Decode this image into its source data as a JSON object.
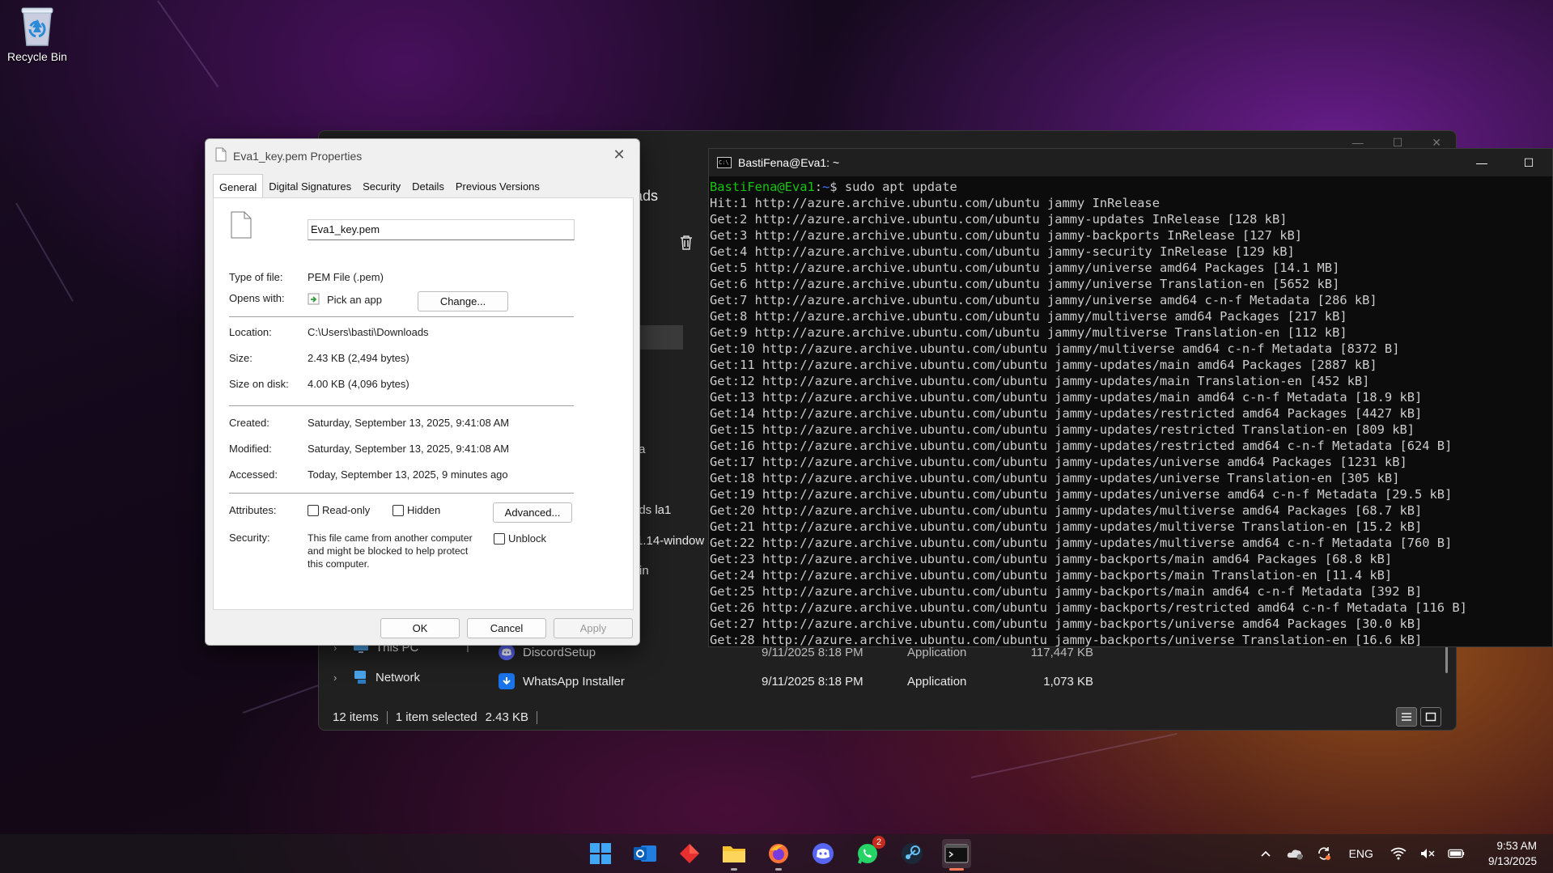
{
  "desktop": {
    "recycle_bin_label": "Recycle Bin"
  },
  "explorer": {
    "title_fragment": "ads",
    "fragments": [
      "ta",
      "nds la1",
      "1.14-window",
      "in"
    ],
    "nav": [
      {
        "label": "This PC"
      },
      {
        "label": "Network"
      }
    ],
    "rows": [
      {
        "name": "DiscordSetup",
        "date": "9/11/2025 8:18 PM",
        "type": "Application",
        "size": "117,447 KB"
      },
      {
        "name": "WhatsApp Installer",
        "date": "9/11/2025 8:18 PM",
        "type": "Application",
        "size": "1,073 KB"
      }
    ],
    "status": {
      "items": "12 items",
      "selected": "1 item selected",
      "size": "2.43 KB"
    }
  },
  "terminal": {
    "title": "BastiFena@Eva1: ~",
    "prompt_user": "BastiFena@Eva1",
    "prompt_sep": ":",
    "prompt_path": "~",
    "prompt_cmd": "$ sudo apt update",
    "lines": [
      "Hit:1 http://azure.archive.ubuntu.com/ubuntu jammy InRelease",
      "Get:2 http://azure.archive.ubuntu.com/ubuntu jammy-updates InRelease [128 kB]",
      "Get:3 http://azure.archive.ubuntu.com/ubuntu jammy-backports InRelease [127 kB]",
      "Get:4 http://azure.archive.ubuntu.com/ubuntu jammy-security InRelease [129 kB]",
      "Get:5 http://azure.archive.ubuntu.com/ubuntu jammy/universe amd64 Packages [14.1 MB]",
      "Get:6 http://azure.archive.ubuntu.com/ubuntu jammy/universe Translation-en [5652 kB]",
      "Get:7 http://azure.archive.ubuntu.com/ubuntu jammy/universe amd64 c-n-f Metadata [286 kB]",
      "Get:8 http://azure.archive.ubuntu.com/ubuntu jammy/multiverse amd64 Packages [217 kB]",
      "Get:9 http://azure.archive.ubuntu.com/ubuntu jammy/multiverse Translation-en [112 kB]",
      "Get:10 http://azure.archive.ubuntu.com/ubuntu jammy/multiverse amd64 c-n-f Metadata [8372 B]",
      "Get:11 http://azure.archive.ubuntu.com/ubuntu jammy-updates/main amd64 Packages [2887 kB]",
      "Get:12 http://azure.archive.ubuntu.com/ubuntu jammy-updates/main Translation-en [452 kB]",
      "Get:13 http://azure.archive.ubuntu.com/ubuntu jammy-updates/main amd64 c-n-f Metadata [18.9 kB]",
      "Get:14 http://azure.archive.ubuntu.com/ubuntu jammy-updates/restricted amd64 Packages [4427 kB]",
      "Get:15 http://azure.archive.ubuntu.com/ubuntu jammy-updates/restricted Translation-en [809 kB]",
      "Get:16 http://azure.archive.ubuntu.com/ubuntu jammy-updates/restricted amd64 c-n-f Metadata [624 B]",
      "Get:17 http://azure.archive.ubuntu.com/ubuntu jammy-updates/universe amd64 Packages [1231 kB]",
      "Get:18 http://azure.archive.ubuntu.com/ubuntu jammy-updates/universe Translation-en [305 kB]",
      "Get:19 http://azure.archive.ubuntu.com/ubuntu jammy-updates/universe amd64 c-n-f Metadata [29.5 kB]",
      "Get:20 http://azure.archive.ubuntu.com/ubuntu jammy-updates/multiverse amd64 Packages [68.7 kB]",
      "Get:21 http://azure.archive.ubuntu.com/ubuntu jammy-updates/multiverse Translation-en [15.2 kB]",
      "Get:22 http://azure.archive.ubuntu.com/ubuntu jammy-updates/multiverse amd64 c-n-f Metadata [760 B]",
      "Get:23 http://azure.archive.ubuntu.com/ubuntu jammy-backports/main amd64 Packages [68.8 kB]",
      "Get:24 http://azure.archive.ubuntu.com/ubuntu jammy-backports/main Translation-en [11.4 kB]",
      "Get:25 http://azure.archive.ubuntu.com/ubuntu jammy-backports/main amd64 c-n-f Metadata [392 B]",
      "Get:26 http://azure.archive.ubuntu.com/ubuntu jammy-backports/restricted amd64 c-n-f Metadata [116 B]",
      "Get:27 http://azure.archive.ubuntu.com/ubuntu jammy-backports/universe amd64 Packages [30.0 kB]",
      "Get:28 http://azure.archive.ubuntu.com/ubuntu jammy-backports/universe Translation-en [16.6 kB]"
    ]
  },
  "dialog": {
    "title": "Eva1_key.pem Properties",
    "tabs": [
      "General",
      "Digital Signatures",
      "Security",
      "Details",
      "Previous Versions"
    ],
    "file_name": "Eva1_key.pem",
    "type_label": "Type of file:",
    "type_value": "PEM File (.pem)",
    "opens_label": "Opens with:",
    "opens_value": "Pick an app",
    "change_button": "Change...",
    "location_label": "Location:",
    "location_value": "C:\\Users\\basti\\Downloads",
    "size_label": "Size:",
    "size_value": "2.43 KB (2,494 bytes)",
    "size_disk_label": "Size on disk:",
    "size_disk_value": "4.00 KB (4,096 bytes)",
    "created_label": "Created:",
    "created_value": "Saturday, September 13, 2025, 9:41:08 AM",
    "modified_label": "Modified:",
    "modified_value": "Saturday, September 13, 2025, 9:41:08 AM",
    "accessed_label": "Accessed:",
    "accessed_value": "Today, September 13, 2025, 9 minutes ago",
    "attributes_label": "Attributes:",
    "readonly_label": "Read-only",
    "hidden_label": "Hidden",
    "advanced_button": "Advanced...",
    "security_label": "Security:",
    "security_text_1": "This file came from another computer",
    "security_text_2": "and might be blocked to help protect",
    "security_text_3": "this computer.",
    "unblock_label": "Unblock",
    "ok_button": "OK",
    "cancel_button": "Cancel",
    "apply_button": "Apply"
  },
  "taskbar": {
    "whatsapp_badge": "2",
    "lang": "ENG",
    "time": "9:53 AM",
    "date": "9/13/2025"
  },
  "colors": {
    "accent": "#0067c0",
    "terminal_user": "#16c60c",
    "terminal_path": "#3b78ff"
  }
}
